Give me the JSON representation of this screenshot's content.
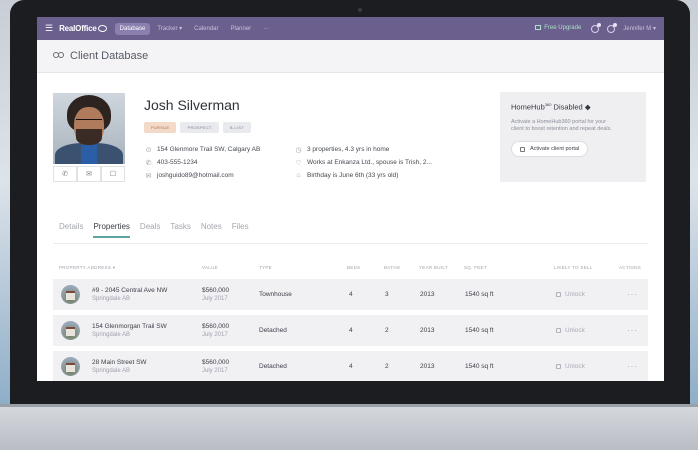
{
  "topbar": {
    "logo": "RealOffice",
    "nav": [
      {
        "label": "Database",
        "active": true
      },
      {
        "label": "Tracker ▾",
        "active": false
      },
      {
        "label": "Calendar",
        "active": false
      },
      {
        "label": "Planner",
        "active": false
      },
      {
        "label": "···",
        "active": false
      }
    ],
    "upgrade_label": "Free Upgrade",
    "user_name": "Jennifer M ▾"
  },
  "page": {
    "title": "Client Database"
  },
  "client": {
    "name": "Josh Silverman",
    "tags": [
      "PURSUE",
      "PROSPECT",
      "B-LIST"
    ],
    "address": "154 Glenmore Trail SW, Calgary AB",
    "phone": "403-555-1234",
    "email": "joshguido89@hotmail.com",
    "properties_summary": "3 properties, 4.3 yrs in home",
    "work": "Works at Enkanza Ltd., spouse is Trish, 2...",
    "birthday": "Birthday is June 6th (33 yrs old)"
  },
  "homehub": {
    "title": "HomeHub",
    "title_sup": "360",
    "title_suffix": "Disabled",
    "description": "Activate a HomeHub360 portal for your client to boost retention and repeat deals.",
    "button_label": "Activate client portal"
  },
  "tabs": [
    {
      "label": "Details",
      "active": false
    },
    {
      "label": "Properties",
      "active": true
    },
    {
      "label": "Deals",
      "active": false
    },
    {
      "label": "Tasks",
      "active": false
    },
    {
      "label": "Notes",
      "active": false
    },
    {
      "label": "Files",
      "active": false
    }
  ],
  "table": {
    "headers": {
      "address": "PROPERTY ADDRESS ▾",
      "value": "VALUE",
      "type": "TYPE",
      "beds": "BEDS",
      "baths": "BATHS",
      "year": "YEAR BUILT",
      "sqft": "SQ. FEET",
      "likely": "LIKELY TO SELL",
      "actions": "ACTIONS"
    },
    "rows": [
      {
        "address": "#9 - 2045 Central Ave NW",
        "city": "Springdale AB",
        "value": "$560,000",
        "date": "July 2017",
        "type": "Townhouse",
        "beds": "4",
        "baths": "3",
        "year": "2013",
        "sqft": "1540 sq ft",
        "likely": "Unlock",
        "actions": "···"
      },
      {
        "address": "154 Glenmorgan Trail SW",
        "city": "Springdale AB",
        "value": "$560,000",
        "date": "July 2017",
        "type": "Detached",
        "beds": "4",
        "baths": "2",
        "year": "2013",
        "sqft": "1540 sq ft",
        "likely": "Unlock",
        "actions": "···"
      },
      {
        "address": "28 Main Street SW",
        "city": "Springdale AB",
        "value": "$560,000",
        "date": "July 2017",
        "type": "Detached",
        "beds": "4",
        "baths": "2",
        "year": "2013",
        "sqft": "1540 sq ft",
        "likely": "Unlock",
        "actions": "···"
      }
    ]
  }
}
